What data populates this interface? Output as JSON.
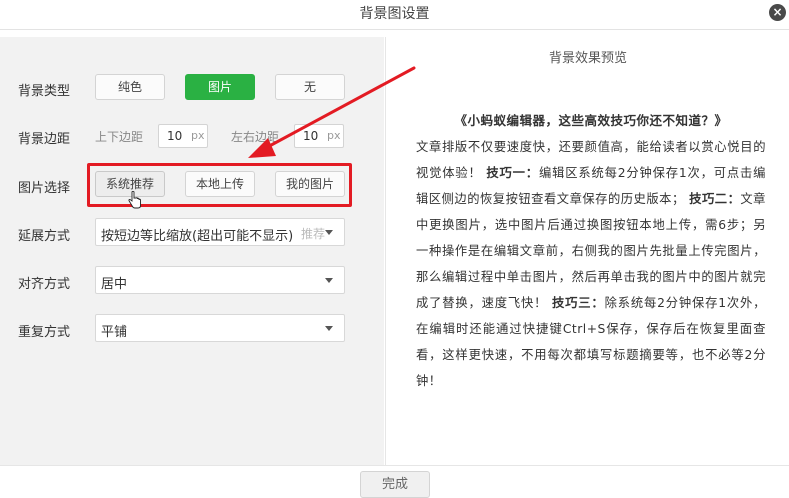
{
  "dialog": {
    "title": "背景图设置",
    "close_glyph": "×"
  },
  "settings": {
    "bg_type": {
      "label": "背景类型",
      "options": [
        "纯色",
        "图片",
        "无"
      ],
      "selected": "图片"
    },
    "bg_margin": {
      "label": "背景边距",
      "vertical_label": "上下边距",
      "vertical_value": "10",
      "horizontal_label": "左右边距",
      "horizontal_value": "10",
      "unit": "px"
    },
    "image_select": {
      "label": "图片选择",
      "buttons": [
        "系统推荐",
        "本地上传",
        "我的图片"
      ]
    },
    "extend_mode": {
      "label": "延展方式",
      "value": "按短边等比缩放(超出可能不显示)",
      "tag": "推荐"
    },
    "align_mode": {
      "label": "对齐方式",
      "value": "居中"
    },
    "repeat_mode": {
      "label": "重复方式",
      "value": "平铺"
    }
  },
  "preview": {
    "title": "背景效果预览",
    "heading": "《小蚂蚁编辑器，这些高效技巧你还不知道？》",
    "p1": "文章排版不仅要速度快，还要颜值高，能给读者以赏心悦目的视觉体验！",
    "tip1_label": "技巧一：",
    "tip1_text": "编辑区系统每2分钟保存1次，可点击编辑区侧边的恢复按钮查看文章保存的历史版本；",
    "tip2_label": "技巧二：",
    "tip2_text": "文章中更换图片，选中图片后通过换图按钮本地上传，需6步；另一种操作是在编辑文章前，右侧我的图片先批量上传完图片，那么编辑过程中单击图片，然后再单击我的图片中的图片就完成了替换，速度飞快！",
    "tip3_label": "技巧三：",
    "tip3_text": "除系统每2分钟保存1次外，在编辑时还能通过快捷键Ctrl+S保存，保存后在恢复里面查看，这样更快速，不用每次都填写标题摘要等，也不必等2分钟！"
  },
  "footer": {
    "done_label": "完成"
  },
  "colors": {
    "accent_green": "#2ab143",
    "annotation_red": "#e31b23"
  }
}
